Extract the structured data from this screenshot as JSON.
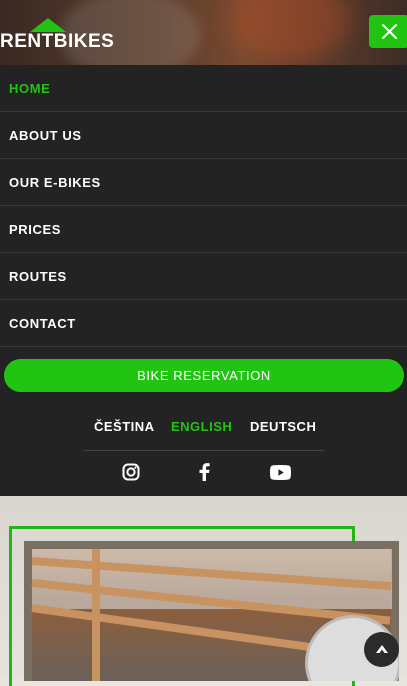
{
  "header": {
    "logo_text": "RENTBIKES",
    "close_icon": "close-icon"
  },
  "menu": {
    "items": [
      {
        "label": "HOME",
        "active": true
      },
      {
        "label": "ABOUT US",
        "active": false
      },
      {
        "label": "OUR E-BIKES",
        "active": false
      },
      {
        "label": "PRICES",
        "active": false
      },
      {
        "label": "ROUTES",
        "active": false
      },
      {
        "label": "CONTACT",
        "active": false
      }
    ],
    "reservation_label": "BIKE RESERVATION",
    "languages": [
      {
        "label": "ČEŠTINA",
        "active": false
      },
      {
        "label": "ENGLISH",
        "active": true
      },
      {
        "label": "DEUTSCH",
        "active": false
      }
    ],
    "social_icons": [
      "instagram-icon",
      "facebook-icon",
      "youtube-icon"
    ]
  },
  "colors": {
    "accent": "#22c414",
    "menu_bg": "#232323"
  },
  "scroll_top_icon": "arrow-up-icon"
}
